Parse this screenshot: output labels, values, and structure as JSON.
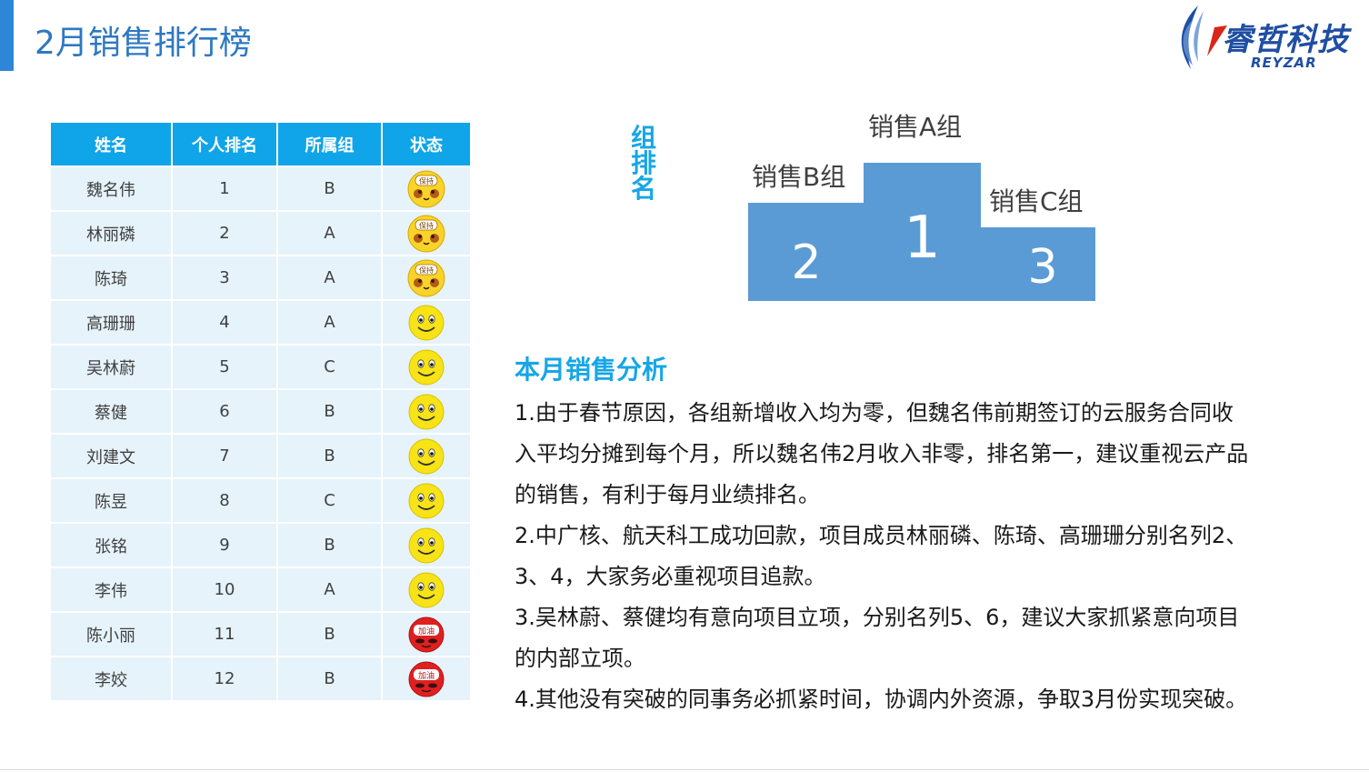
{
  "title": "2月销售排行榜",
  "logo": {
    "name": "睿哲科技",
    "sub": "REYZAR"
  },
  "table": {
    "headers": [
      "姓名",
      "个人排名",
      "所属组",
      "状态"
    ],
    "rows": [
      {
        "name": "魏名伟",
        "rank": "1",
        "group": "B",
        "status": "保持"
      },
      {
        "name": "林丽磷",
        "rank": "2",
        "group": "A",
        "status": "保持"
      },
      {
        "name": "陈琦",
        "rank": "3",
        "group": "A",
        "status": "保持"
      },
      {
        "name": "高珊珊",
        "rank": "4",
        "group": "A",
        "status": "smile"
      },
      {
        "name": "吴林蔚",
        "rank": "5",
        "group": "C",
        "status": "smile"
      },
      {
        "name": "蔡健",
        "rank": "6",
        "group": "B",
        "status": "smile"
      },
      {
        "name": "刘建文",
        "rank": "7",
        "group": "B",
        "status": "smile"
      },
      {
        "name": "陈昱",
        "rank": "8",
        "group": "C",
        "status": "smile"
      },
      {
        "name": "张铭",
        "rank": "9",
        "group": "B",
        "status": "smile"
      },
      {
        "name": "李伟",
        "rank": "10",
        "group": "A",
        "status": "smile"
      },
      {
        "name": "陈小丽",
        "rank": "11",
        "group": "B",
        "status": "加油"
      },
      {
        "name": "李姣",
        "rank": "12",
        "group": "B",
        "status": "加油"
      }
    ]
  },
  "group_rank": {
    "label": "组排名",
    "first": {
      "name": "销售A组",
      "place": "1"
    },
    "second": {
      "name": "销售B组",
      "place": "2"
    },
    "third": {
      "name": "销售C组",
      "place": "3"
    }
  },
  "analysis": {
    "title": "本月销售分析",
    "lines": [
      "1.由于春节原因，各组新增收入均为零，但魏名伟前期签订的云服务合同收",
      "入平均分摊到每个月，所以魏名伟2月收入非零，排名第一，建议重视云产品",
      "的销售，有利于每月业绩排名。",
      "2.中广核、航天科工成功回款，项目成员林丽磷、陈琦、高珊珊分别名列2、",
      "3、4，大家务必重视项目追款。",
      "3.吴林蔚、蔡健均有意向项目立项，分别名列5、6，建议大家抓紧意向项目",
      "的内部立项。",
      "4.其他没有突破的同事务必抓紧时间，协调内外资源，争取3月份实现突破。"
    ]
  },
  "colors": {
    "accent": "#2e86d6",
    "header": "#0fa5e8",
    "row": "#e6f3fb",
    "podium": "#5b9bd5",
    "highlight": "#16a6e6"
  }
}
